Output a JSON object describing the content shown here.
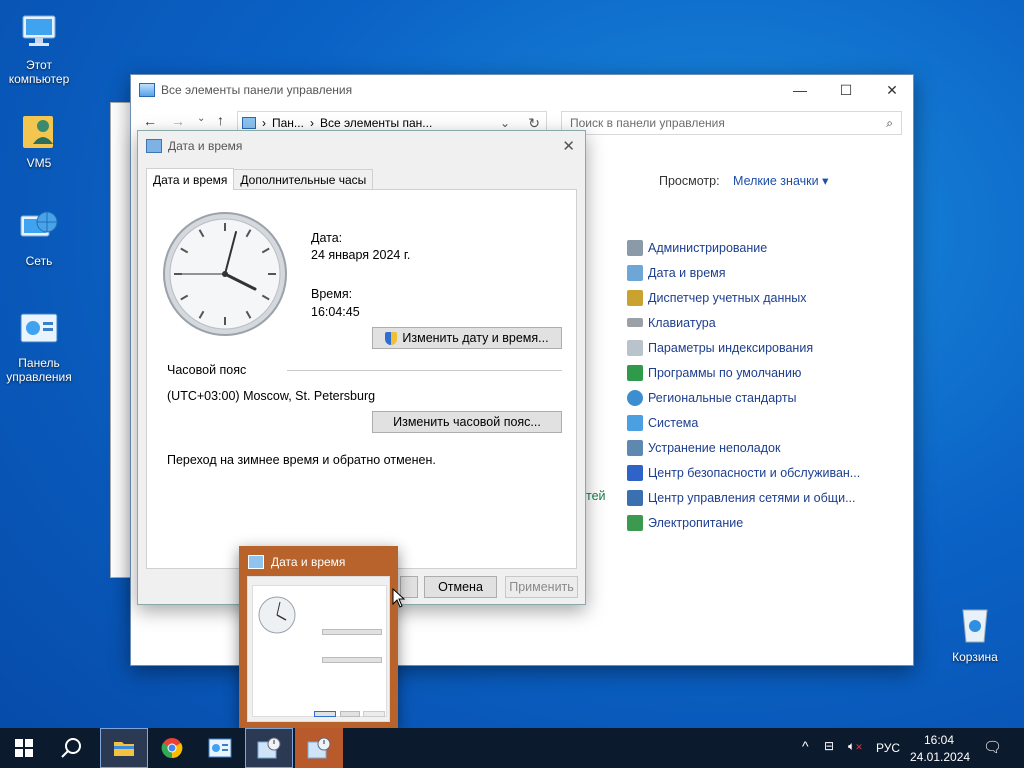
{
  "desktop": {
    "icons": [
      {
        "label": "Этот компьютер"
      },
      {
        "label": "VM5"
      },
      {
        "label": "Сеть"
      },
      {
        "label": "Панель управления"
      },
      {
        "label": "Корзина"
      }
    ]
  },
  "control_panel": {
    "title": "Все элементы панели управления",
    "breadcrumb": [
      "Пан...",
      "Все элементы пан..."
    ],
    "search_placeholder": "Поиск в панели управления",
    "view_label": "Просмотр:",
    "view_value": "Мелкие значки",
    "side_fragment": "тей",
    "items": [
      {
        "label": "Администрирование",
        "icon": "admin-icon"
      },
      {
        "label": "Дата и время",
        "icon": "datetime-icon"
      },
      {
        "label": "Диспетчер учетных данных",
        "icon": "credential-icon"
      },
      {
        "label": "Клавиатура",
        "icon": "keyboard-icon"
      },
      {
        "label": "Параметры индексирования",
        "icon": "indexing-icon"
      },
      {
        "label": "Программы по умолчанию",
        "icon": "default-programs-icon"
      },
      {
        "label": "Региональные стандарты",
        "icon": "region-icon"
      },
      {
        "label": "Система",
        "icon": "system-icon"
      },
      {
        "label": "Устранение неполадок",
        "icon": "troubleshoot-icon"
      },
      {
        "label": "Центр безопасности и обслуживан...",
        "icon": "security-flag-icon"
      },
      {
        "label": "Центр управления сетями и общи...",
        "icon": "network-icon"
      },
      {
        "label": "Электропитание",
        "icon": "power-icon"
      }
    ]
  },
  "dialog": {
    "title": "Дата и время",
    "tabs": [
      "Дата и время",
      "Дополнительные часы"
    ],
    "date_label": "Дата:",
    "date_value": "24 января 2024 г.",
    "time_label": "Время:",
    "time_value": "16:04:45",
    "change_datetime_button": "Изменить дату и время...",
    "timezone_label": "Часовой пояс",
    "timezone_value": "(UTC+03:00) Moscow, St. Petersburg",
    "change_timezone_button": "Изменить часовой пояс...",
    "dst_note": "Переход на зимнее время и обратно отменен.",
    "cancel_button": "Отмена",
    "apply_button": "Применить"
  },
  "thumbnail": {
    "title": "Дата и время"
  },
  "taskbar": {
    "language": "РУС",
    "time": "16:04",
    "date": "24.01.2024"
  },
  "colors": {
    "desktop": "#0b63c6",
    "taskbar": "#0c1a2e",
    "link": "#1e3f8f",
    "thumbnail_highlight": "#b8622c"
  }
}
